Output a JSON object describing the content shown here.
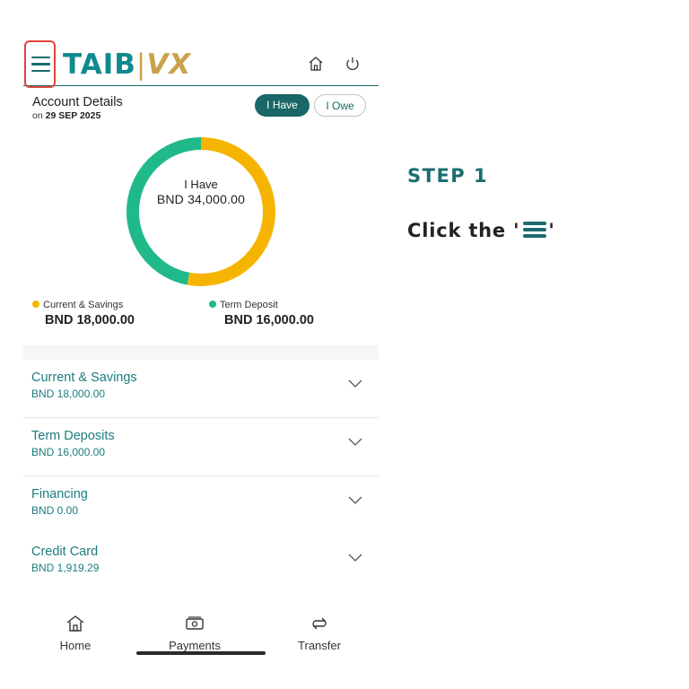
{
  "header": {
    "logo_main": "TAIB",
    "logo_sep": "|",
    "logo_suffix": "VX",
    "menu_icon": "hamburger-menu-icon",
    "home_icon": "home-icon",
    "power_icon": "power-icon"
  },
  "account": {
    "title": "Account Details",
    "date_prefix": "on",
    "date": "29 SEP 2025"
  },
  "toggle": {
    "have": "I Have",
    "owe": "I Owe"
  },
  "donut": {
    "label": "I Have",
    "value": "BND 34,000.00",
    "segments": [
      {
        "name": "Current & Savings",
        "value": 18000,
        "color": "#f5b400"
      },
      {
        "name": "Term Deposit",
        "value": 16000,
        "color": "#20b98a"
      }
    ]
  },
  "legend": [
    {
      "label": "Current & Savings",
      "amount": "BND 18,000.00",
      "color": "#f5b400"
    },
    {
      "label": "Term Deposit",
      "amount": "BND 16,000.00",
      "color": "#20b98a"
    }
  ],
  "accounts": [
    {
      "name": "Current & Savings",
      "amount": "BND 18,000.00"
    },
    {
      "name": "Term Deposits",
      "amount": "BND 16,000.00"
    },
    {
      "name": "Financing",
      "amount": "BND 0.00"
    },
    {
      "name": "Credit Card",
      "amount": "BND 1,919.29"
    }
  ],
  "nav": {
    "home": "Home",
    "payments": "Payments",
    "transfer": "Transfer"
  },
  "instructions": {
    "step": "STEP 1",
    "text_before": "Click the '",
    "text_after": "'"
  },
  "colors": {
    "brand_teal": "#1d6b6d",
    "highlight_red": "#e0443a",
    "gold": "#c9a24a"
  }
}
